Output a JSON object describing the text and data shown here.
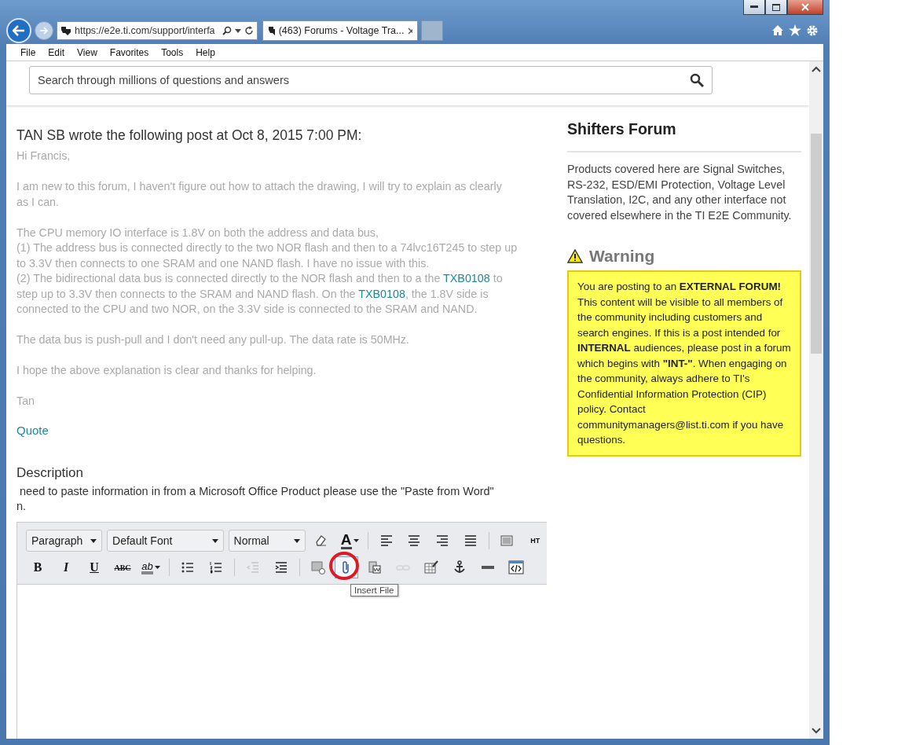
{
  "browser": {
    "address": "https://e2e.ti.com/support/interfa",
    "tabs": [
      {
        "title": "(463) Forums - Voltage Tra...",
        "selected": true
      }
    ],
    "menu": [
      "File",
      "Edit",
      "View",
      "Favorites",
      "Tools",
      "Help"
    ]
  },
  "search": {
    "placeholder": "Search through millions of questions and answers"
  },
  "post": {
    "heading": "TAN SB wrote the following post at Oct 8, 2015 7:00 PM:",
    "paragraphs": [
      [
        [
          {
            "kind": "plain",
            "text": "Hi Francis,"
          }
        ]
      ],
      [
        [
          {
            "kind": "plain",
            "text": "I am new to this forum, I haven't figure out how to attach the drawing, I will try to explain as clearly"
          }
        ],
        [
          {
            "kind": "plain",
            "text": "as I can."
          }
        ]
      ],
      [
        [
          {
            "kind": "plain",
            "text": "The CPU memory IO interface is 1.8V on both the address and data bus,"
          }
        ],
        [
          {
            "kind": "plain",
            "text": "(1) The address bus is connected directly to the two NOR flash and then to a 74lvc16T245 to step up"
          }
        ],
        [
          {
            "kind": "plain",
            "text": "to 3.3V then connects to one SRAM and one NAND flash. I have no issue with this."
          }
        ],
        [
          {
            "kind": "plain",
            "text": "(2) The bidirectional data bus is connected directly to the NOR flash and then to a the "
          },
          {
            "kind": "link",
            "text": "TXB0108"
          },
          {
            "kind": "plain",
            "text": " to"
          }
        ],
        [
          {
            "kind": "plain",
            "text": "step up to 3.3V then connects to the SRAM and NAND flash. On the "
          },
          {
            "kind": "link",
            "text": "TXB0108"
          },
          {
            "kind": "plain",
            "text": ", the 1.8V side is"
          }
        ],
        [
          {
            "kind": "plain",
            "text": "connected to the CPU and two NOR, on the 3.3V side is connected to the SRAM and NAND."
          }
        ]
      ],
      [
        [
          {
            "kind": "plain",
            "text": "The data bus is push-pull and I don't need any pull-up. The data rate is 50MHz."
          }
        ]
      ],
      [
        [
          {
            "kind": "plain",
            "text": "I hope the above explanation is clear and thanks for helping."
          }
        ]
      ],
      [
        [
          {
            "kind": "plain",
            "text": "Tan"
          }
        ]
      ]
    ],
    "quote_link": "Quote"
  },
  "description": {
    "label": "Description",
    "help_lines": [
      " need to paste information in from a Microsoft Office Product please use the \"Paste from Word\"",
      "n."
    ]
  },
  "editor": {
    "top_toolbar": [
      {
        "kind": "select",
        "label": "Paragraph"
      },
      {
        "kind": "select",
        "label": "Default Font"
      },
      {
        "kind": "select",
        "label": "Normal"
      },
      {
        "kind": "icon",
        "disabled": false,
        "highlighted": false,
        "circled": false
      },
      {
        "kind": "text",
        "label": "A"
      },
      {
        "kind": "separator"
      },
      {
        "kind": "icon",
        "disabled": false,
        "highlighted": false,
        "circled": false
      },
      {
        "kind": "icon",
        "disabled": false,
        "highlighted": false,
        "circled": false
      },
      {
        "kind": "icon",
        "disabled": false,
        "highlighted": false,
        "circled": false
      },
      {
        "kind": "icon",
        "disabled": false,
        "highlighted": false,
        "circled": false
      },
      {
        "kind": "separator"
      },
      {
        "kind": "icon",
        "disabled": false,
        "highlighted": false,
        "circled": false
      },
      {
        "kind": "text",
        "label": "HT"
      }
    ],
    "bottom_toolbar": [
      {
        "kind": "text",
        "label": "B"
      },
      {
        "kind": "text",
        "label": "I"
      },
      {
        "kind": "text",
        "label": "U"
      },
      {
        "kind": "text",
        "label": "ABC"
      },
      {
        "kind": "text",
        "label": "ab"
      },
      {
        "kind": "separator"
      },
      {
        "kind": "icon",
        "disabled": false,
        "highlighted": false,
        "circled": false
      },
      {
        "kind": "icon",
        "disabled": false,
        "highlighted": false,
        "circled": false
      },
      {
        "kind": "separator"
      },
      {
        "kind": "icon",
        "disabled": true,
        "highlighted": false,
        "circled": false
      },
      {
        "kind": "icon",
        "disabled": false,
        "highlighted": false,
        "circled": false
      },
      {
        "kind": "separator"
      },
      {
        "kind": "icon",
        "disabled": false,
        "highlighted": false,
        "circled": false
      },
      {
        "kind": "icon",
        "disabled": false,
        "highlighted": true,
        "circled": true,
        "tooltip": "Insert File"
      },
      {
        "kind": "icon",
        "disabled": false,
        "highlighted": false,
        "circled": false
      },
      {
        "kind": "icon",
        "disabled": true,
        "highlighted": false,
        "circled": false
      },
      {
        "kind": "icon",
        "disabled": false,
        "highlighted": false,
        "circled": false
      },
      {
        "kind": "icon",
        "disabled": false,
        "highlighted": false,
        "circled": false
      },
      {
        "kind": "icon",
        "disabled": false,
        "highlighted": false,
        "circled": false
      },
      {
        "kind": "icon",
        "disabled": false,
        "highlighted": false,
        "circled": false
      }
    ]
  },
  "sidebar": {
    "title": "Shifters Forum",
    "description": "Products covered here are Signal Switches, RS-232, ESD/EMI Protection, Voltage Level Translation, I2C, and any other interface not covered elsewhere in the TI E2E Community.",
    "warning_title": "Warning",
    "warning_text": "You are posting to an **EXTERNAL FORUM!** This content will be visible to all members of the community including customers and search engines. If this is a post intended for **INTERNAL** audiences, please post in a forum which begins with **\"INT-\"**. When engaging on the community, always adhere to TI's Confidential Information Protection (CIP) policy. Contact communitymanagers@list.ti.com if you have questions."
  }
}
